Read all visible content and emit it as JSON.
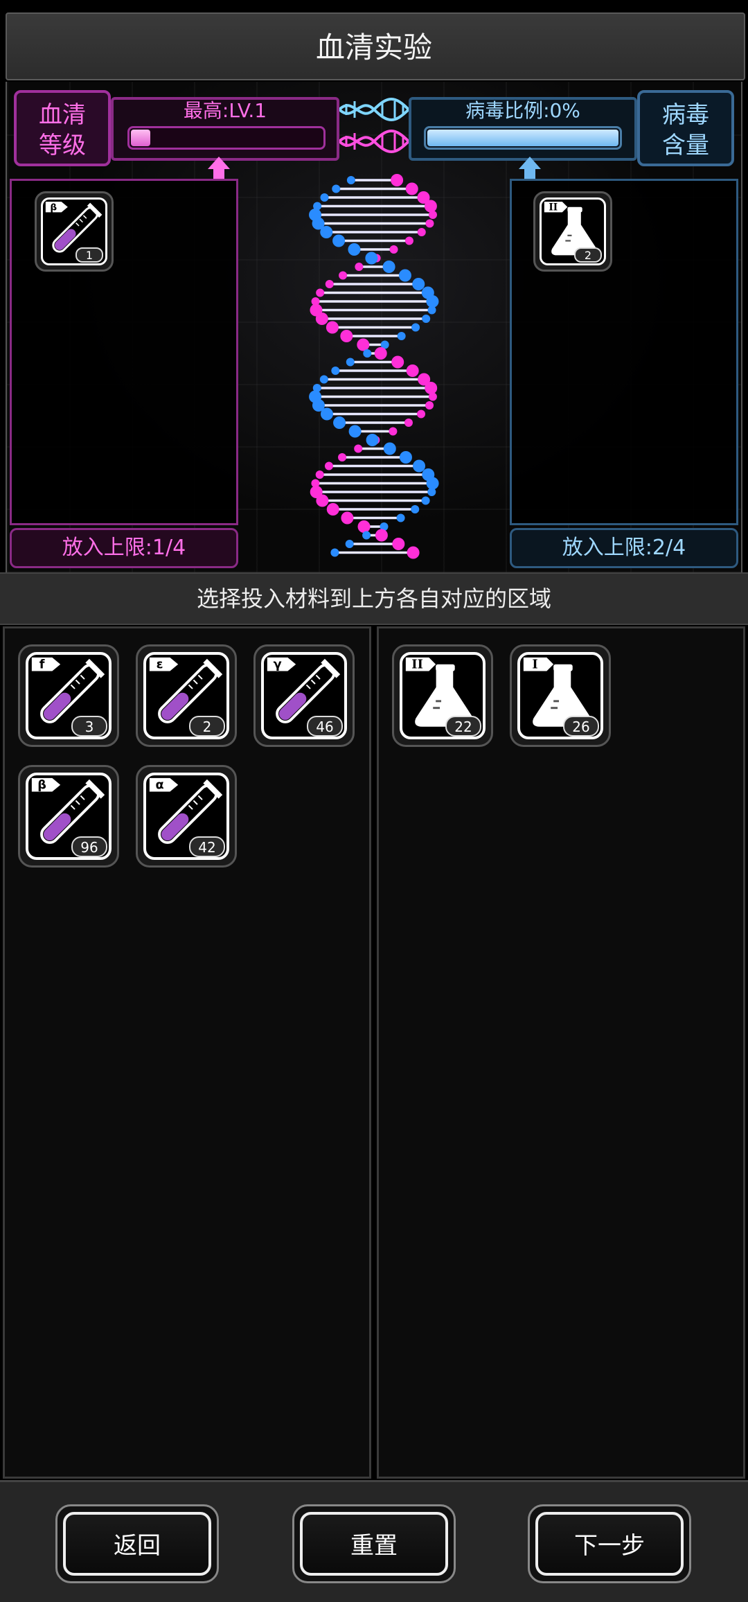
{
  "title": "血清实验",
  "serum": {
    "label": "血清等级",
    "label_line1": "血清",
    "label_line2": "等级",
    "bar_text": "最高:LV.1",
    "level_fraction": 0.1,
    "limit_text": "放入上限:1/4",
    "color": "#ff6fe8",
    "placed": [
      {
        "symbol": "β",
        "count": "1",
        "icon": "test-tube-icon"
      }
    ]
  },
  "virus": {
    "label": "病毒含量",
    "label_line1": "病毒",
    "label_line2": "含量",
    "bar_text": "病毒比例:0%",
    "fill_fraction": 1.0,
    "limit_text": "放入上限:2/4",
    "color": "#9fd8ff",
    "placed": [
      {
        "symbol": "II",
        "count": "2",
        "icon": "flask-icon"
      }
    ]
  },
  "instruction": "选择投入材料到上方各自对应的区域",
  "inventory_left": [
    {
      "symbol": "f",
      "count": "3",
      "icon": "test-tube-icon"
    },
    {
      "symbol": "ε",
      "count": "2",
      "icon": "test-tube-icon"
    },
    {
      "symbol": "γ",
      "count": "46",
      "icon": "test-tube-icon"
    },
    {
      "symbol": "β",
      "count": "96",
      "icon": "test-tube-icon"
    },
    {
      "symbol": "α",
      "count": "42",
      "icon": "test-tube-icon"
    }
  ],
  "inventory_right": [
    {
      "symbol": "II",
      "count": "22",
      "icon": "flask-icon"
    },
    {
      "symbol": "I",
      "count": "26",
      "icon": "flask-icon"
    }
  ],
  "buttons": {
    "back": "返回",
    "reset": "重置",
    "next": "下一步"
  }
}
